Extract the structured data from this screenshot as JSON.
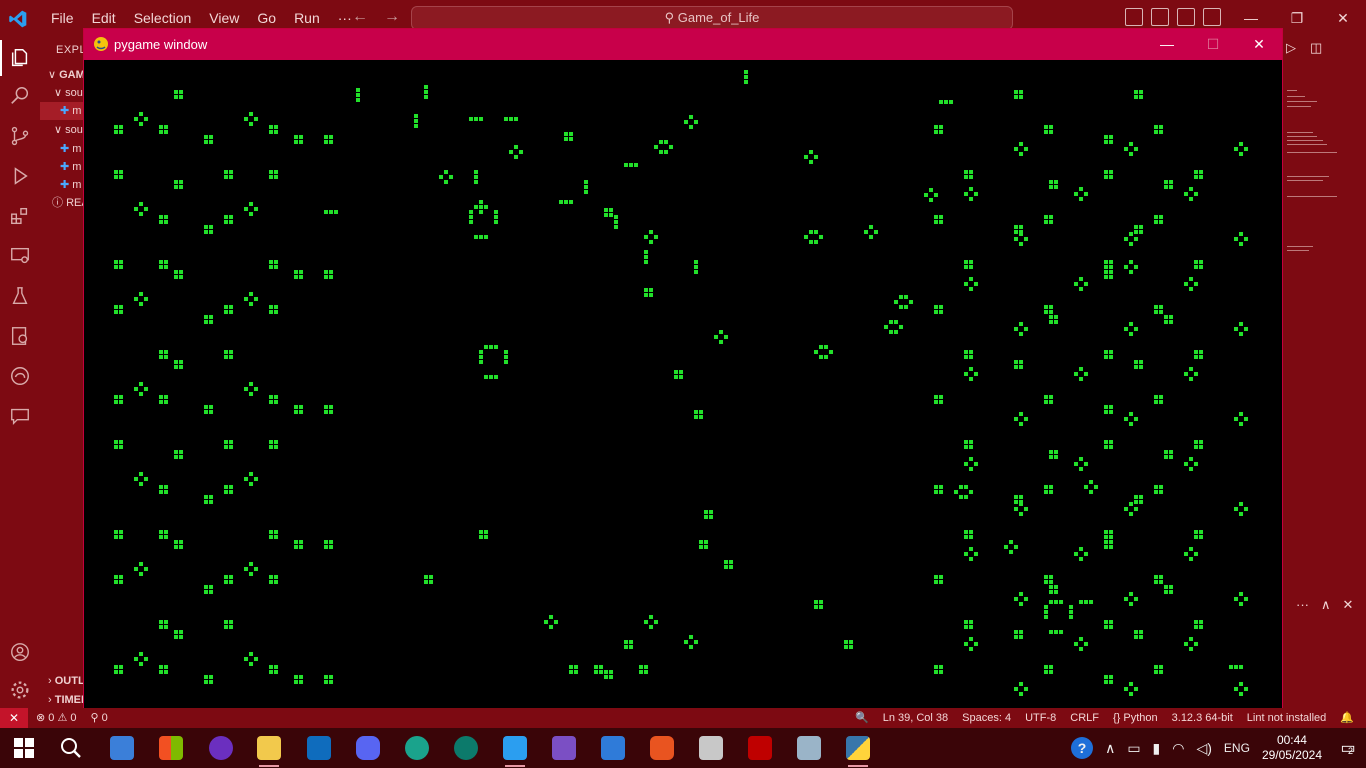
{
  "vscode": {
    "menu": [
      "File",
      "Edit",
      "Selection",
      "View",
      "Go",
      "Run",
      "···"
    ],
    "search": "Game_of_Life",
    "window_controls": {
      "minimize": "—",
      "restore": "❐",
      "close": "✕"
    }
  },
  "sidebar": {
    "title": "EXPLO",
    "rows": [
      {
        "label": "GAME",
        "indent": 0,
        "arrow": "∨"
      },
      {
        "label": "sou",
        "indent": 1,
        "arrow": "∨"
      },
      {
        "label": "m",
        "indent": 2,
        "arrow": "",
        "selected": true
      },
      {
        "label": "sou",
        "indent": 1,
        "arrow": "∨"
      },
      {
        "label": "m",
        "indent": 2,
        "arrow": ""
      },
      {
        "label": "m",
        "indent": 2,
        "arrow": ""
      },
      {
        "label": "m",
        "indent": 2,
        "arrow": ""
      },
      {
        "label": "REA",
        "indent": 1,
        "arrow": "ⓘ"
      }
    ],
    "bottom": [
      "OUTLI",
      "TIMEL"
    ]
  },
  "pygame": {
    "title": "pygame window",
    "controls": {
      "minimize": "—",
      "maximize": "☐",
      "close": "✕"
    },
    "cell_color": "#22e02a",
    "background": "#000000"
  },
  "statusbar": {
    "remote": "✕",
    "problems": "⊗ 0 ⚠ 0",
    "ports": "⚲ 0",
    "zoom_icon": "🔍",
    "position": "Ln 39, Col 38",
    "spaces": "Spaces: 4",
    "encoding": "UTF-8",
    "eol": "CRLF",
    "language": "{} Python",
    "interpreter": "3.12.3 64-bit",
    "lint": "Lint not installed",
    "bell": "🔔"
  },
  "taskbar": {
    "apps": [
      "search",
      "file-explorer",
      "microsoft-store",
      "media-player",
      "folder",
      "outlook",
      "discord",
      "edge",
      "edge-dev",
      "vscode",
      "visual-studio",
      "virtualbox",
      "ubuntu",
      "wsl",
      "filezilla",
      "remote-desktop",
      "python"
    ],
    "tray": {
      "help": "?",
      "arrow": "∧",
      "lang": "ENG",
      "time": "00:44",
      "date": "29/05/2024",
      "notifications": "2"
    }
  },
  "colors": {
    "accent": "#7d0a12",
    "pygame_titlebar": "#c8004a",
    "statusbar_remote": "#c4142a"
  }
}
